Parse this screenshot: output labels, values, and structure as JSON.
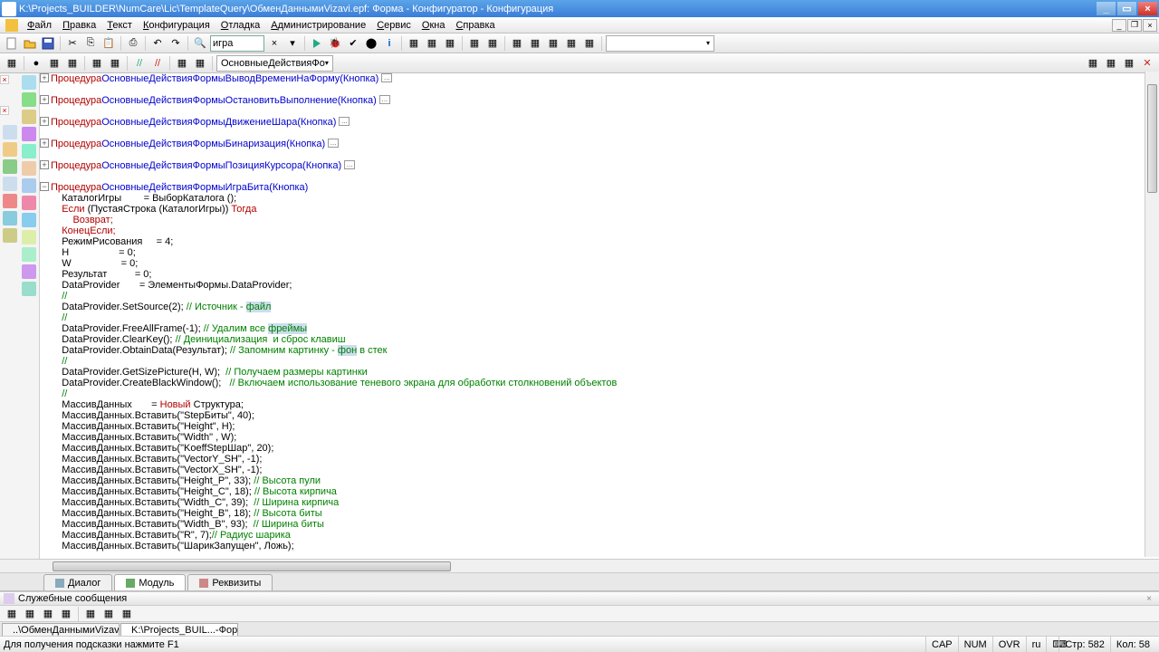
{
  "window": {
    "title": "K:\\Projects_BUILDER\\NumCare\\Lic\\TemplateQuery\\ОбменДаннымиVizavi.epf: Форма - Конфигуратор - Конфигурация"
  },
  "menu": {
    "file": "Файл",
    "edit": "Правка",
    "text": "Текст",
    "config": "Конфигурация",
    "debug": "Отладка",
    "admin": "Администрирование",
    "service": "Сервис",
    "windows": "Окна",
    "help": "Справка"
  },
  "toolbar": {
    "search_value": "игра",
    "combo_value": "ОсновныеДействияФо"
  },
  "code": {
    "proc_kw": "Процедура",
    "proc1": "ОсновныеДействияФормыВыводВремениНаФорму(Кнопка)",
    "proc2": "ОсновныеДействияФормыОстановитьВыполнение(Кнопка)",
    "proc3": "ОсновныеДействияФормыДвижениеШара(Кнопка)",
    "proc4": "ОсновныеДействияФормыБинаризация(Кнопка)",
    "proc5": "ОсновныеДействияФормыПозицияКурсора(Кнопка)",
    "proc6": "ОсновныеДействияФормыИграБита(Кнопка)",
    "l1": "    КаталогИгры        = ВыборКаталога ();",
    "l2a": "    Если ",
    "l2b": "(ПустаяСтрока (КаталогИгры)) ",
    "l2c": "Тогда",
    "l3": "        Возврат;",
    "l4": "    КонецЕсли;",
    "l5": "    РежимРисования     = 4;",
    "l6": "    H                  = 0;",
    "l7": "    W                  = 0;",
    "l8": "    Результат          = 0;",
    "l9": "    DataProvider       = ЭлементыФормы.DataProvider;",
    "l10": "    //",
    "l11a": "    DataProvider.SetSource(2); ",
    "l11b": "// Источник - ",
    "l11c": "файл",
    "l12": "    //",
    "l13a": "    DataProvider.FreeAllFrame(-1); ",
    "l13b": "// Удалим все ",
    "l13c": "фреймы",
    "l14a": "    DataProvider.ClearKey(); ",
    "l14b": "// Деинициализация  и сброс клавиш",
    "l15a": "    DataProvider.ObtainData(Результат); ",
    "l15b": "// Запомним картинку - ",
    "l15c": "фон",
    "l15d": " в стек",
    "l16": "    //",
    "l17a": "    DataProvider.GetSizePicture(H, W);  ",
    "l17b": "// Получаем размеры картинки",
    "l18a": "    DataProvider.CreateBlackWindow();   ",
    "l18b": "// Включаем использование теневого экрана для обработки столкновений объектов",
    "l19": "    //",
    "l20a": "    МассивДанных       = ",
    "l20b": "Новый ",
    "l20c": "Структура;",
    "l21": "    МассивДанных.Вставить(\"StepБиты\", 40);",
    "l22": "    МассивДанных.Вставить(\"Height\", H);",
    "l23": "    МассивДанных.Вставить(\"Width\" , W);",
    "l24": "    МассивДанных.Вставить(\"KoeffStepШар\", 20);",
    "l25": "    МассивДанных.Вставить(\"VectorY_SH\", -1);",
    "l26": "    МассивДанных.Вставить(\"VectorX_SH\", -1);",
    "l27a": "    МассивДанных.Вставить(\"Height_P\", 33); ",
    "l27b": "// Высота пули",
    "l28a": "    МассивДанных.Вставить(\"Height_C\", 18); ",
    "l28b": "// Высота кирпича",
    "l29a": "    МассивДанных.Вставить(\"Width_C\", 39);  ",
    "l29b": "// Ширина кирпича",
    "l30a": "    МассивДанных.Вставить(\"Height_B\", 18); ",
    "l30b": "// Высота биты",
    "l31a": "    МассивДанных.Вставить(\"Width_B\", 93);  ",
    "l31b": "// Ширина биты",
    "l32a": "    МассивДанных.Вставить(\"R\", 7);",
    "l32b": "// Радиус шарика",
    "l33": "    МассивДанных.Вставить(\"ШарикЗапущен\", Ложь);"
  },
  "tabs": {
    "dialog": "Диалог",
    "module": "Модуль",
    "requisites": "Реквизиты"
  },
  "panels": {
    "messages": "Служебные сообщения"
  },
  "doctabs": {
    "t1": "..\\ОбменДаннымиVizavi...",
    "t2": "K:\\Projects_BUIL...-Форма"
  },
  "status": {
    "hint": "Для получения подсказки нажмите F1",
    "cap": "CAP",
    "num": "NUM",
    "ovr": "OVR",
    "lang": "ru",
    "row_lbl": "Стр:",
    "row": "582",
    "col_lbl": "Кол:",
    "col": "58"
  },
  "ellipsis": "..."
}
